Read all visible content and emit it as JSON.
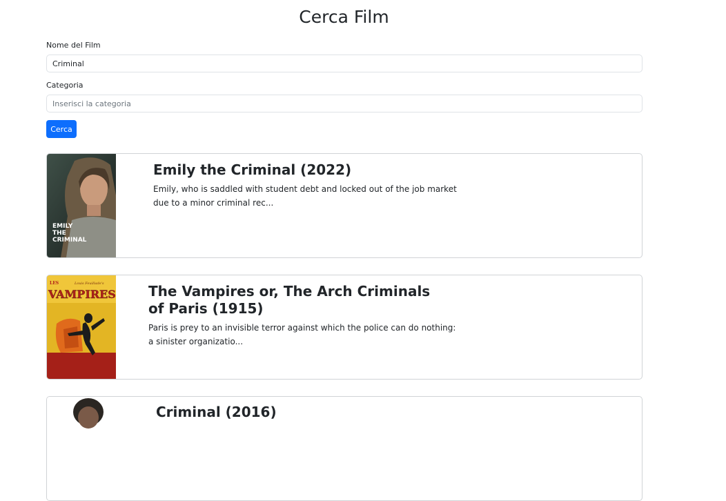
{
  "page_title": "Cerca Film",
  "form": {
    "name_label": "Nome del Film",
    "name_value": "Criminal",
    "category_label": "Categoria",
    "category_placeholder": "Inserisci la categoria",
    "category_value": "",
    "search_button": "Cerca"
  },
  "results": [
    {
      "title": "Emily the Criminal (2022)",
      "overview": "Emily, who is saddled with student debt and locked out of the job market due to a minor criminal rec...",
      "poster_text": [
        "EMILY",
        "THE",
        "CRIMINAL"
      ]
    },
    {
      "title": "The Vampires or, The Arch Criminals of Paris (1915)",
      "overview": "Paris is prey to an invisible terror against which the police can do nothing: a sinister organizatio...",
      "poster_text": [
        "LES",
        "VAMPIRES",
        "Louis Feuillade's"
      ]
    },
    {
      "title": "Criminal (2016)",
      "overview": ""
    }
  ]
}
